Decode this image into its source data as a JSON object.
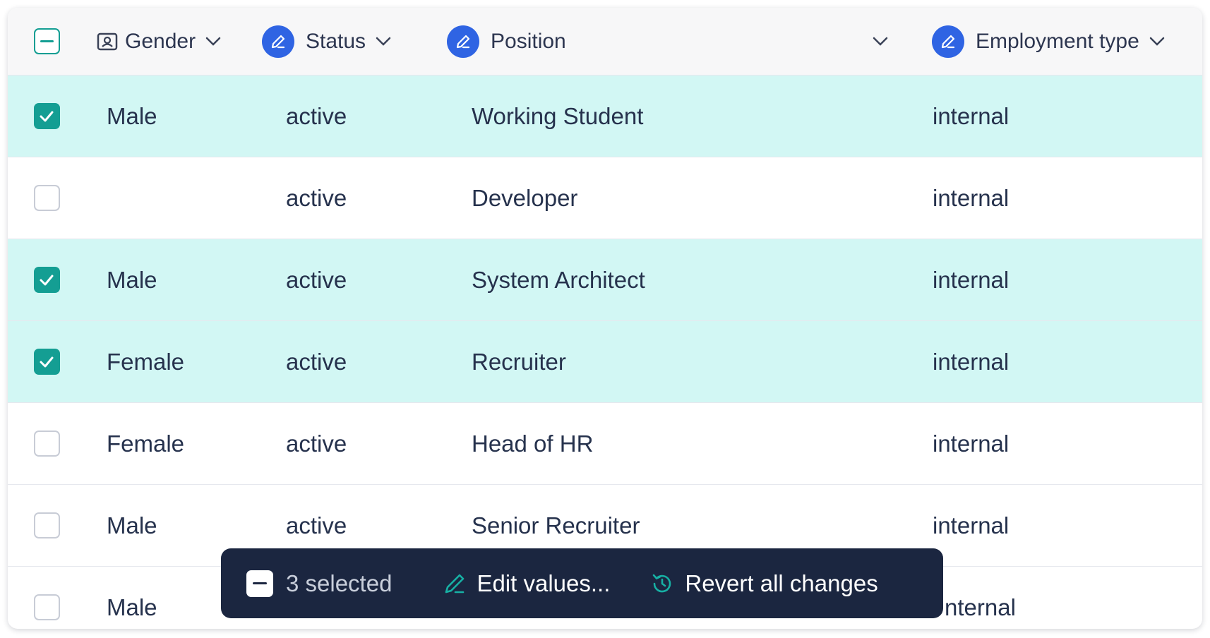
{
  "header": {
    "columns": [
      {
        "label": "Gender",
        "icon": "id-card-icon"
      },
      {
        "label": "Status",
        "icon": "pencil-icon"
      },
      {
        "label": "Position",
        "icon": "pencil-icon"
      },
      {
        "label": "Employment type",
        "icon": "pencil-icon"
      }
    ]
  },
  "rows": [
    {
      "selected": true,
      "gender": "Male",
      "status": "active",
      "position": "Working Student",
      "employment_type": "internal"
    },
    {
      "selected": false,
      "gender": "",
      "status": "active",
      "position": "Developer",
      "employment_type": "internal"
    },
    {
      "selected": true,
      "gender": "Male",
      "status": "active",
      "position": "System Architect",
      "employment_type": "internal"
    },
    {
      "selected": true,
      "gender": "Female",
      "status": "active",
      "position": "Recruiter",
      "employment_type": "internal"
    },
    {
      "selected": false,
      "gender": "Female",
      "status": "active",
      "position": "Head of HR",
      "employment_type": "internal"
    },
    {
      "selected": false,
      "gender": "Male",
      "status": "active",
      "position": "Senior Recruiter",
      "employment_type": "internal"
    },
    {
      "selected": false,
      "gender": "Male",
      "status": "",
      "position": "",
      "employment_type": "nternal"
    }
  ],
  "toolbar": {
    "selected_label": "3 selected",
    "edit_label": "Edit values...",
    "revert_label": "Revert all changes"
  },
  "colors": {
    "accent_teal": "#149e93",
    "selected_row_bg": "#d2f7f4",
    "pencil_badge": "#2f64e3",
    "toolbar_bg": "#1b2640"
  }
}
